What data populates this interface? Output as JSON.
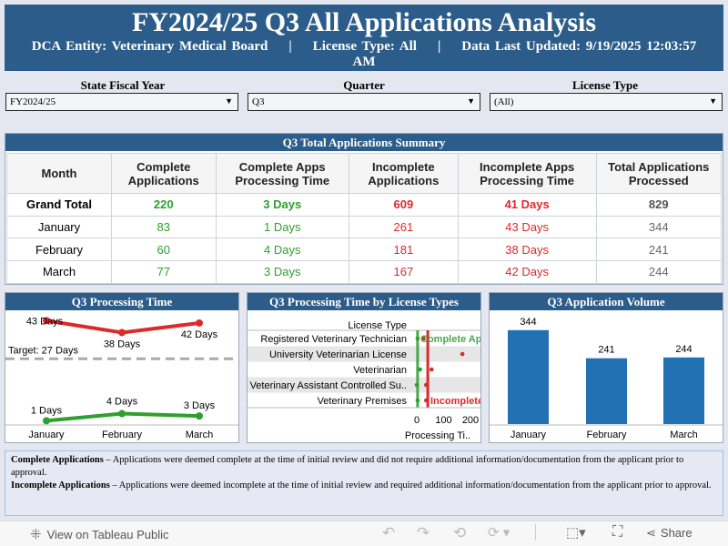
{
  "header": {
    "title": "FY2024/25 Q3 All Applications Analysis",
    "subtitle": "DCA Entity: Veterinary Medical Board    |    License Type: All    |    Data Last Updated: 9/19/2025 12:03:57 AM"
  },
  "filters": [
    {
      "label": "State Fiscal Year",
      "value": "FY2024/25"
    },
    {
      "label": "Quarter",
      "value": "Q3"
    },
    {
      "label": "License Type",
      "value": "(All)"
    }
  ],
  "summary": {
    "title": "Q3 Total Applications Summary",
    "columns": [
      "Month",
      "Complete Applications",
      "Complete Apps Processing Time",
      "Incomplete Applications",
      "Incomplete Apps Processing Time",
      "Total Applications Processed"
    ],
    "rows": [
      [
        "Grand Total",
        "220",
        "3 Days",
        "609",
        "41 Days",
        "829"
      ],
      [
        "January",
        "83",
        "1 Days",
        "261",
        "43 Days",
        "344"
      ],
      [
        "February",
        "60",
        "4 Days",
        "181",
        "38 Days",
        "241"
      ],
      [
        "March",
        "77",
        "3 Days",
        "167",
        "42 Days",
        "244"
      ]
    ]
  },
  "processing": {
    "title": "Q3 Processing Time",
    "target_label": "Target: 27 Days",
    "target": 27,
    "months": [
      "January",
      "February",
      "March"
    ],
    "incomplete": [
      43,
      38,
      42
    ],
    "incomplete_labels": [
      "43 Days",
      "38 Days",
      "42 Days"
    ],
    "complete": [
      1,
      4,
      3
    ],
    "complete_labels": [
      "1 Days",
      "4 Days",
      "3 Days"
    ],
    "colors": {
      "incomplete": "#dc2a2a",
      "complete": "#2ea02e",
      "target": "#aaaaaa"
    }
  },
  "by_license": {
    "title": "Q3 Processing Time by License Types",
    "row_header": "License Type",
    "axis_label": "Processing Ti..",
    "ticks": [
      "0",
      "100",
      "200"
    ],
    "ref_complete_label": "Complete Ap",
    "ref_incomplete_label": "Incomplete",
    "ref_complete": 3,
    "ref_incomplete": 41,
    "types": [
      {
        "name": "Registered Veterinary Technician",
        "complete": 3,
        "incomplete": 25
      },
      {
        "name": "University Veterinarian License",
        "complete": null,
        "incomplete": 170
      },
      {
        "name": "Veterinarian",
        "complete": 12,
        "incomplete": 55
      },
      {
        "name": "Veterinary Assistant Controlled Su..",
        "complete": 0,
        "incomplete": 35
      },
      {
        "name": "Veterinary Premises",
        "complete": 3,
        "incomplete": 35
      }
    ]
  },
  "volume": {
    "title": "Q3 Application Volume",
    "months": [
      "January",
      "February",
      "March"
    ],
    "values": [
      344,
      241,
      244
    ],
    "color": "#2271b3"
  },
  "notes": [
    {
      "term": "Complete Applications",
      "text": " – Applications were deemed complete at the time of initial review and did not require additional information/documentation from the applicant prior to approval."
    },
    {
      "term": "Incomplete Applications",
      "text": " – Applications were deemed incomplete at the time of initial review and required additional information/documentation from the applicant prior to approval."
    }
  ],
  "toolbar": {
    "view_label": "View on Tableau Public",
    "share_label": "Share"
  }
}
